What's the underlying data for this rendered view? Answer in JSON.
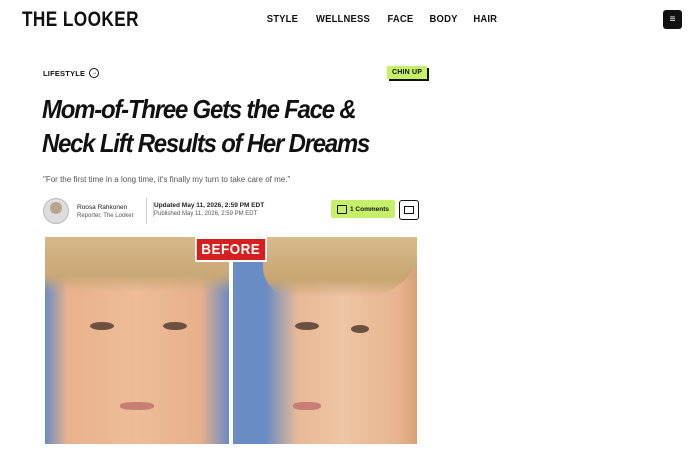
{
  "site": {
    "logo": "THE LOOKER"
  },
  "nav": {
    "items": [
      "STYLE",
      "WELLNESS",
      "FACE",
      "BODY",
      "HAIR"
    ]
  },
  "menu": {
    "icon": "hamburger-icon",
    "glyph": "≡"
  },
  "article": {
    "category": "LIFESTYLE",
    "tag": "CHIN UP",
    "headline": "Mom-of-Three Gets the Face & Neck Lift Results of Her Dreams",
    "dek": "\"For the first time in a long time, it's finally my turn to take care of me.\"",
    "author": {
      "name": "Roosa Rahkonen",
      "role": "Reporter, The Looker"
    },
    "updated": "Updated May 11, 2026, 2:59 PM EDT",
    "published": "Published May 11, 2026, 2:59 PM EDT",
    "comments_label": "1 Comments",
    "image_overlay": "BEFORE"
  },
  "colors": {
    "accent": "#c6f06a",
    "before_red": "#d6201f"
  }
}
